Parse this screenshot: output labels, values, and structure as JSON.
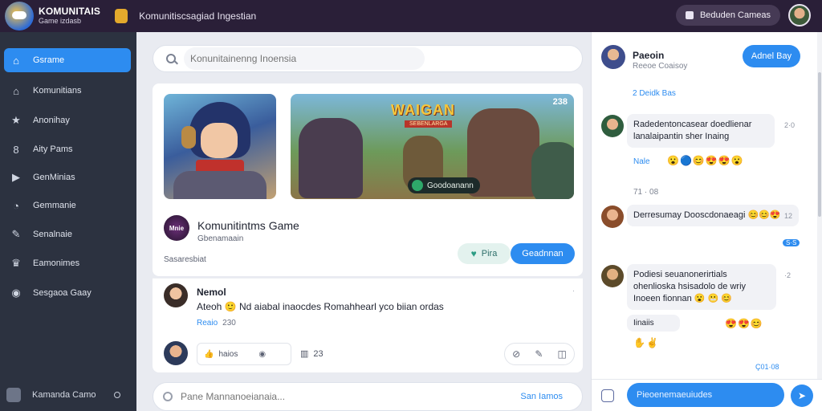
{
  "topbar": {
    "brand_title": "KOMUNITAIS",
    "brand_subtitle": "Game izdasb",
    "page_title": "Komunitiscsagiad Ingestian",
    "action_label": "Beduden Cameas"
  },
  "sidebar": {
    "items": [
      {
        "label": "Gsrame",
        "icon": "home-icon",
        "active": true
      },
      {
        "label": "Komunitians",
        "icon": "community-icon",
        "active": false
      },
      {
        "label": "Anonihay",
        "icon": "star-icon",
        "active": false
      },
      {
        "label": "Aity Pams",
        "icon": "user-icon",
        "active": false
      },
      {
        "label": "GenMinias",
        "icon": "play-icon",
        "active": false
      },
      {
        "label": "Gemmanie",
        "icon": "chat-icon",
        "active": false
      },
      {
        "label": "Senalnaie",
        "icon": "edit-icon",
        "active": false
      },
      {
        "label": "Eamonimes",
        "icon": "trophy-icon",
        "active": false
      },
      {
        "label": "Sesgaoa Gaay",
        "icon": "location-icon",
        "active": false
      }
    ],
    "footer_label": "Kamanda Camo"
  },
  "main": {
    "search_placeholder": "Konunitainenng Inoensia",
    "banner": {
      "title": "WAIGAN",
      "tag": "SEBENLARGA",
      "count": "238",
      "pill": "Goodoanann"
    },
    "game": {
      "logo_text": "Mnie",
      "name": "Komunitintms Game",
      "subtitle": "Gbenamaain",
      "meta": "Sasaresbiat",
      "like_label": "Pira",
      "join_label": "Geadnnan"
    },
    "post": {
      "author": "Nemol",
      "text": "Ateoh 🙂 Nd aiabal inaocdes Romahhearl yco biian ordas",
      "reply_label": "Reaio",
      "reply_count": "230",
      "likes_label": "haios",
      "stat_value": "23",
      "corner_time": "·"
    },
    "composer_placeholder": "Pane Mannanoeianaia...",
    "composer_send": "San Iamos"
  },
  "chat": {
    "header_name": "Paeoin",
    "header_sub": "Reeoe Coaisoy",
    "header_button": "Adnel Bay",
    "online_label": "2 Deidk Bas",
    "messages": [
      {
        "text": "Radedentoncasear doedlienar lanalaipantin sher Inaing",
        "time": "2·0",
        "name": "Nale",
        "reactions": "😮🔵😊😍😍😮"
      },
      {
        "day": "71 · 08"
      },
      {
        "text": "Derresumay Dooscdonaeagi 😊😊😍",
        "time": "12",
        "tag": "S·S"
      },
      {
        "text": "Podiesi seuanonerirtials ohenlioska hsisadolo de wriy Inoeen fionnan 😮 😬 😊",
        "time": "·2",
        "chip": "Iinaiis",
        "reactions": "😍😍😊"
      }
    ],
    "footer_time": "Ç01·08",
    "input_placeholder": "Pieoenemaeuiudes"
  },
  "colors": {
    "accent": "#2d8cf0",
    "topbar": "#2a1f38",
    "sidebar": "#2c3240"
  }
}
